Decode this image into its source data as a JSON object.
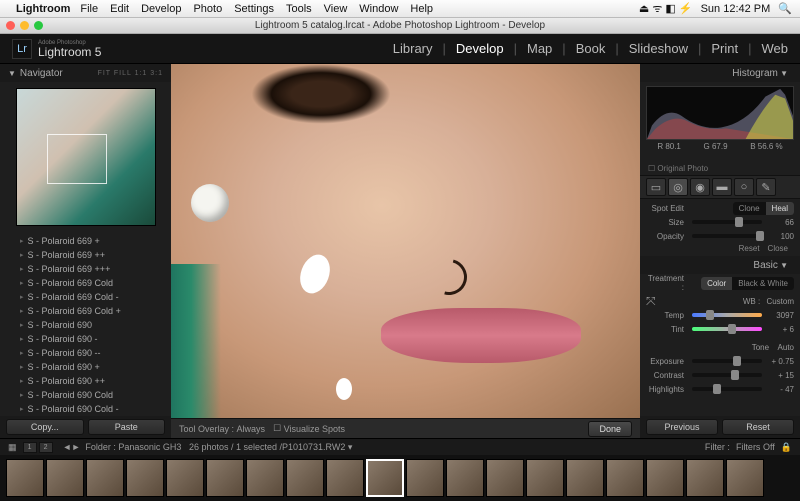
{
  "mac": {
    "app": "Lightroom",
    "menus": [
      "File",
      "Edit",
      "Develop",
      "Photo",
      "Settings",
      "Tools",
      "View",
      "Window",
      "Help"
    ],
    "time": "Sun 12:42 PM"
  },
  "window_title": "Lightroom 5 catalog.lrcat - Adobe Photoshop Lightroom - Develop",
  "brand": {
    "small": "Adobe Photoshop",
    "big": "Lightroom 5",
    "logo": "Lr"
  },
  "modules": [
    "Library",
    "Develop",
    "Map",
    "Book",
    "Slideshow",
    "Print",
    "Web"
  ],
  "active_module": "Develop",
  "navigator": {
    "title": "Navigator",
    "modes": "FIT  FILL  1:1  3:1"
  },
  "presets": [
    "S - Polaroid 669 +",
    "S - Polaroid 669 ++",
    "S - Polaroid 669 +++",
    "S - Polaroid 669 Cold",
    "S - Polaroid 669 Cold -",
    "S - Polaroid 669 Cold +",
    "S - Polaroid 690",
    "S - Polaroid 690 -",
    "S - Polaroid 690 --",
    "S - Polaroid 690 +",
    "S - Polaroid 690 ++",
    "S - Polaroid 690 Cold",
    "S - Polaroid 690 Cold -"
  ],
  "left_buttons": {
    "copy": "Copy...",
    "paste": "Paste"
  },
  "toolbar": {
    "overlay_lbl": "Tool Overlay :",
    "overlay_val": "Always",
    "visualize": "Visualize Spots",
    "done": "Done"
  },
  "histogram": {
    "title": "Histogram",
    "vals": {
      "r": "R  80.1",
      "g": "G  67.9",
      "b": "B  56.6 %"
    },
    "original": "Original Photo"
  },
  "spot": {
    "title": "Spot Edit",
    "clone": "Clone",
    "heal": "Heal",
    "size_lbl": "Size",
    "size_val": "66",
    "opacity_lbl": "Opacity",
    "opacity_val": "100",
    "reset": "Reset",
    "close": "Close"
  },
  "basic": {
    "title": "Basic",
    "treatment": "Treatment :",
    "color": "Color",
    "bw": "Black & White",
    "wb": "WB :",
    "wb_val": "Custom",
    "temp_lbl": "Temp",
    "temp_val": "3097",
    "tint_lbl": "Tint",
    "tint_val": "+ 6",
    "tone": "Tone",
    "auto": "Auto",
    "exposure_lbl": "Exposure",
    "exposure_val": "+ 0.75",
    "contrast_lbl": "Contrast",
    "contrast_val": "+ 15",
    "highlights_lbl": "Highlights",
    "highlights_val": "- 47"
  },
  "right_buttons": {
    "previous": "Previous",
    "reset": "Reset"
  },
  "status": {
    "pages": [
      "1",
      "2"
    ],
    "folder": "Folder : Panasonic GH3",
    "count": "26 photos / 1 selected / ",
    "file": "P1010731.RW2",
    "filter": "Filter :",
    "filters_off": "Filters Off"
  },
  "filmstrip_count": 19
}
